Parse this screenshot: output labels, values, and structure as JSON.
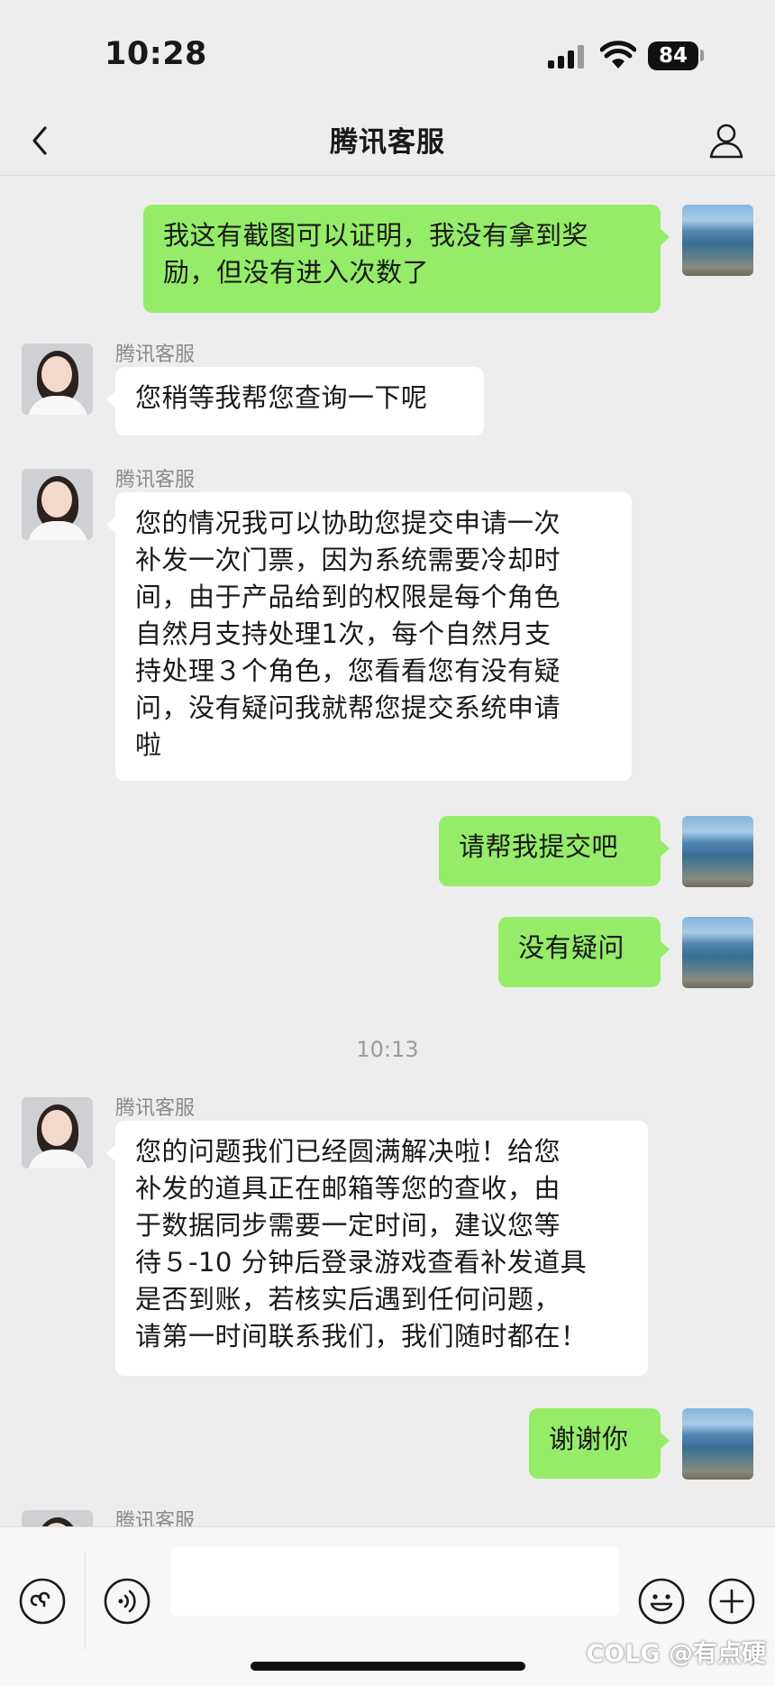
{
  "status_bar": {
    "time": "10:28",
    "battery": "84"
  },
  "nav": {
    "title": "腾讯客服"
  },
  "messages": [
    {
      "from": "self",
      "text": "我这有截图可以证明，我没有拿到奖\n励，但没有进入次数了"
    },
    {
      "from": "agent",
      "name": "腾讯客服",
      "text": "您稍等我帮您查询一下呢"
    },
    {
      "from": "agent",
      "name": "腾讯客服",
      "text": "您的情况我可以协助您提交申请一次\n补发一次门票，因为系统需要冷却时\n间，由于产品给到的权限是每个角色\n自然月支持处理1次，每个自然月支\n持处理３个角色，您看看您有没有疑\n问，没有疑问我就帮您提交系统申请\n啦"
    },
    {
      "from": "self",
      "text": "请帮我提交吧"
    },
    {
      "from": "self",
      "text": "没有疑问"
    },
    {
      "from": "agent",
      "name": "腾讯客服",
      "text": "您的问题我们已经圆满解决啦！给您\n补发的道具正在邮箱等您的查收，由\n于数据同步需要一定时间，建议您等\n待５-10 分钟后登录游戏查看补发道具\n是否到账，若核实后遇到任何问题，\n请第一时间联系我们，我们随时都在！"
    },
    {
      "from": "self",
      "text": "谢谢你"
    },
    {
      "from": "agent",
      "name": "腾讯客服",
      "text": ""
    }
  ],
  "timestamp": "10:13",
  "input_bar": {
    "placeholder": ""
  },
  "watermark": "COLG @有点硬",
  "colors": {
    "self_bubble": "#95ec69",
    "agent_bubble": "#ffffff",
    "background": "#ededed"
  },
  "icons": [
    "back-icon",
    "profile-icon",
    "mini-program-icon",
    "voice-icon",
    "emoji-icon",
    "plus-icon"
  ]
}
